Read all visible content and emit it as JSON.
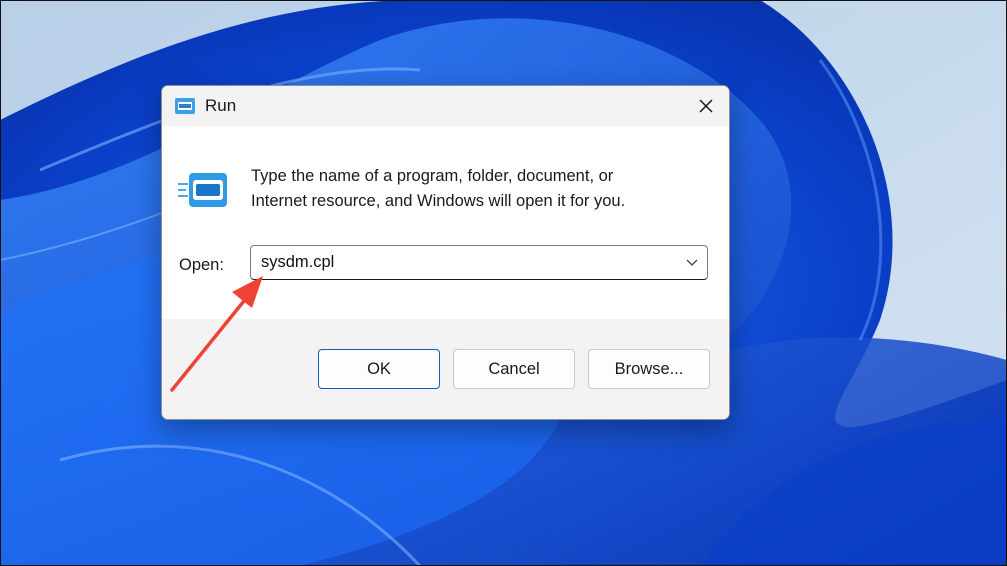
{
  "dialog": {
    "title": "Run",
    "description_line1": "Type the name of a program, folder, document, or",
    "description_line2": "Internet resource, and Windows will open it for you.",
    "open_label": "Open:",
    "open_value": "sysdm.cpl",
    "buttons": {
      "ok": "OK",
      "cancel": "Cancel",
      "browse": "Browse..."
    }
  },
  "icons": {
    "title": "run-icon",
    "close": "close-icon",
    "main": "run-icon",
    "dropdown": "chevron-down-icon",
    "annotation": "red-arrow-annotation"
  },
  "colors": {
    "annotation_arrow": "#ef4136",
    "accent": "#0b5fb7",
    "titlebar": "#f3f3f3",
    "footer": "#f3f3f3"
  }
}
